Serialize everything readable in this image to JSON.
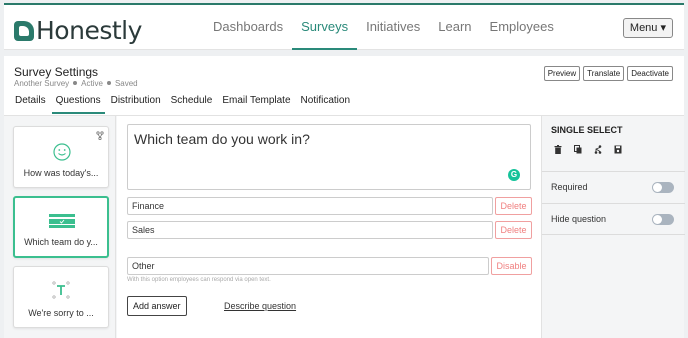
{
  "app": {
    "brand": "Honestly",
    "brand_color": "#2b7a6b"
  },
  "nav": {
    "items": [
      {
        "label": "Dashboards"
      },
      {
        "label": "Surveys"
      },
      {
        "label": "Initiatives"
      },
      {
        "label": "Learn"
      },
      {
        "label": "Employees"
      }
    ],
    "active": "Surveys",
    "menu_label": "Menu ▾"
  },
  "survey": {
    "title": "Survey Settings",
    "name": "Another Survey",
    "status": "Active",
    "save_state": "Saved",
    "actions": {
      "preview": "Preview",
      "translate": "Translate",
      "deactivate": "Deactivate"
    }
  },
  "tabs": [
    {
      "label": "Details"
    },
    {
      "label": "Questions"
    },
    {
      "label": "Distribution"
    },
    {
      "label": "Schedule"
    },
    {
      "label": "Email Template"
    },
    {
      "label": "Notification"
    }
  ],
  "questions": [
    {
      "label": "How was today's...",
      "icon": "smiley-icon"
    },
    {
      "label": "Which team do y...",
      "icon": "single-select-icon"
    },
    {
      "label": "We're sorry to ...",
      "icon": "text-icon"
    }
  ],
  "editor": {
    "question_text": "Which team do you work in?",
    "answers": [
      {
        "value": "Finance"
      },
      {
        "value": "Sales"
      }
    ],
    "delete_label": "Delete",
    "other_value": "Other",
    "disable_label": "Disable",
    "other_hint": "With this option employees can respond via open text.",
    "add_answer_label": "Add answer",
    "describe_label": "Describe question"
  },
  "sidebar": {
    "type_title": "SINGLE SELECT",
    "required_label": "Required",
    "hide_label": "Hide question",
    "required_on": false,
    "hide_on": false
  },
  "colors": {
    "accent": "#2a8a7a",
    "selected_border": "#3bbf8f",
    "danger": "#f08080"
  }
}
